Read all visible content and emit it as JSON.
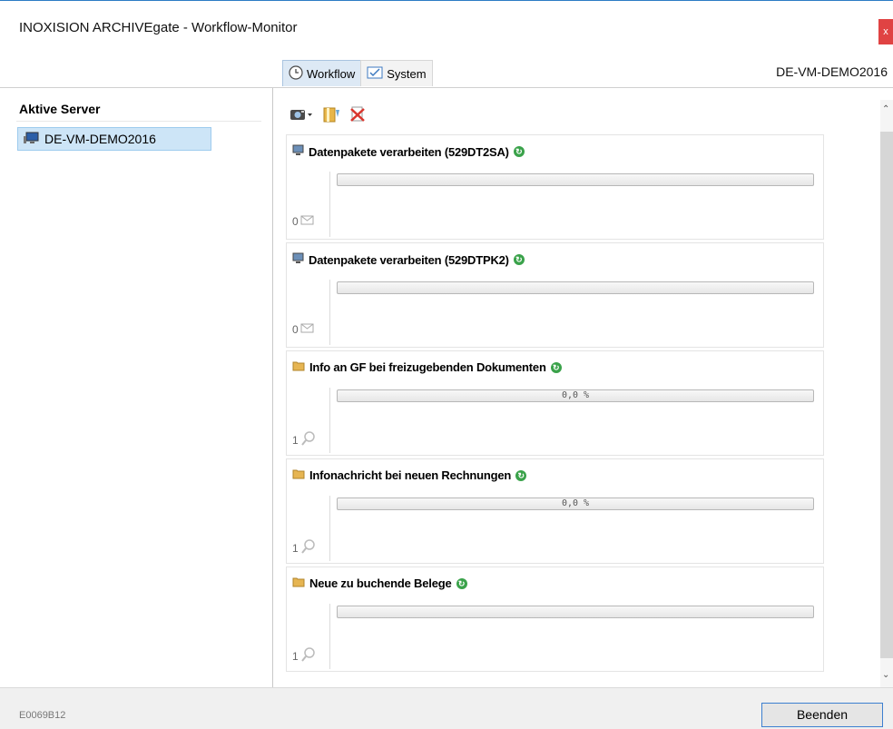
{
  "window": {
    "title": "INOXISION ARCHIVEgate  -  Workflow-Monitor",
    "close_label": "x"
  },
  "tabs": [
    {
      "label": "Workflow",
      "icon": "clock-icon",
      "active": true
    },
    {
      "label": "System",
      "icon": "checkbox-icon",
      "active": false
    }
  ],
  "header_server": "DE-VM-DEMO2016",
  "sidebar": {
    "title": "Aktive Server",
    "servers": [
      {
        "label": "DE-VM-DEMO2016",
        "icon": "computer-icon",
        "selected": true
      }
    ]
  },
  "toolbar": {
    "icons": [
      "camera-icon",
      "book-icon",
      "delete-icon"
    ]
  },
  "workflows": [
    {
      "title": "Datenpakete verarbeiten (529DT2SA)",
      "icon": "monitor-icon",
      "status_icon": "refresh-icon",
      "progress_text": "",
      "count": "0",
      "count_icon": "envelope-icon"
    },
    {
      "title": "Datenpakete verarbeiten (529DTPK2)",
      "icon": "monitor-icon",
      "status_icon": "refresh-icon",
      "progress_text": "",
      "count": "0",
      "count_icon": "envelope-icon"
    },
    {
      "title": "Info an GF bei freizugebenden Dokumenten",
      "icon": "folder-icon",
      "status_icon": "refresh-icon",
      "progress_text": "0,0 %",
      "count": "1",
      "count_icon": "magnifier-icon"
    },
    {
      "title": "Infonachricht bei neuen Rechnungen",
      "icon": "folder-icon",
      "status_icon": "refresh-icon",
      "progress_text": "0,0 %",
      "count": "1",
      "count_icon": "magnifier-icon"
    },
    {
      "title": "Neue zu buchende Belege",
      "icon": "folder-icon",
      "status_icon": "refresh-icon",
      "progress_text": "",
      "count": "1",
      "count_icon": "magnifier-icon"
    }
  ],
  "footer": {
    "code": "E0069B12",
    "quit_label": "Beenden"
  },
  "colors": {
    "accent": "#2d7cc4",
    "close": "#e04343",
    "selection": "#cde5f7",
    "refresh": "#3aa24a"
  }
}
